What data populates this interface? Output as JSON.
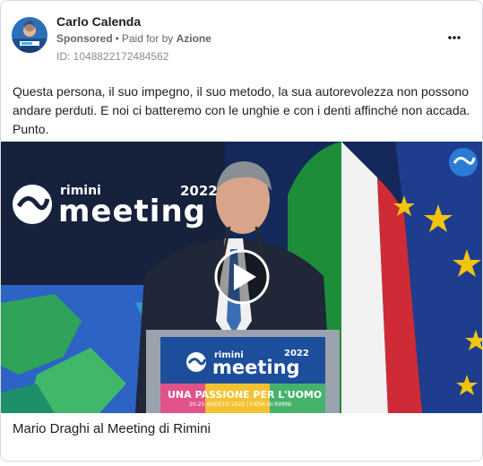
{
  "post": {
    "author": "Carlo Calenda",
    "sponsored_label": "Sponsored",
    "paid_for_prefix": "Paid for by",
    "advertiser": "Azione",
    "id_label": "ID: 1048822172484562",
    "text": "Questa persona, il suo impegno, il suo metodo, la sua autorevolezza non possono andare perduti. E noi ci batteremo con le unghie e con i denti affinché non accada. Punto.",
    "caption": "Mario Draghi al Meeting di Rimini"
  },
  "video": {
    "banner_small": "rimini",
    "banner_big": "meeting",
    "banner_year": "2022",
    "podium_small": "rimini",
    "podium_big": "meeting",
    "podium_year": "2022",
    "podium_slogan": "UNA PASSIONE PER L'UOMO",
    "podium_dates": "20-25 AGOSTO 2022 | FIERA DI RIMINI"
  },
  "icons": {
    "more": "more-options-icon",
    "play": "play-icon",
    "logo": "meeting-logo-icon"
  },
  "colors": {
    "text": "#1c1e21",
    "muted": "#65676b",
    "border": "#d8dadf",
    "podium_blue": "#1d4e9c"
  }
}
